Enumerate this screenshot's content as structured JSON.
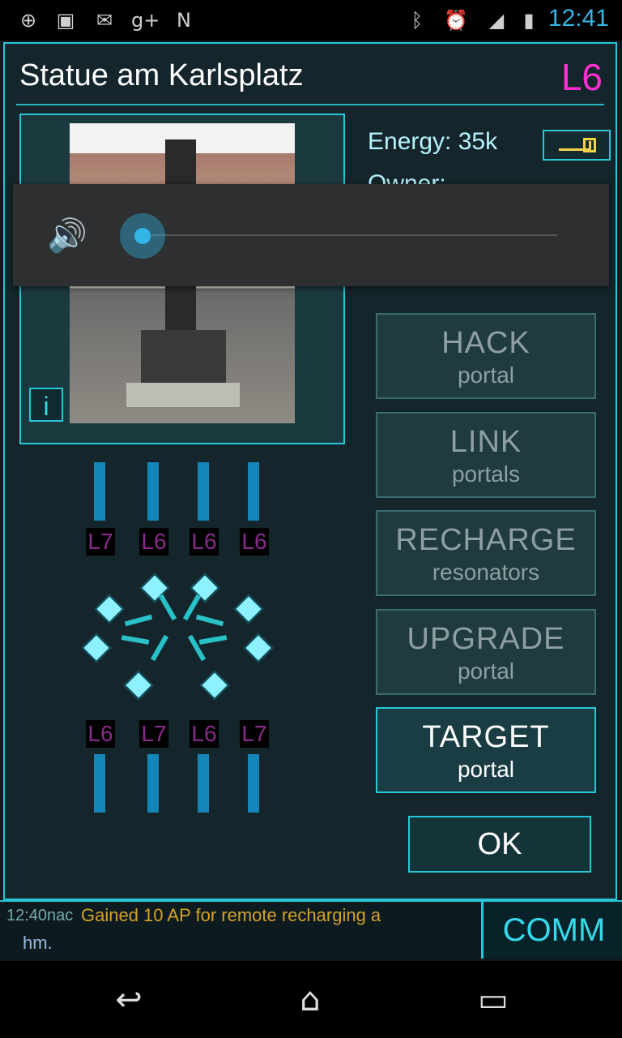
{
  "status_bar": {
    "icons": [
      "location-icon",
      "image-icon",
      "gmail-icon",
      "google-plus-icon",
      "android-icon",
      "bluetooth-icon",
      "alarm-icon",
      "signal-icon",
      "battery-icon"
    ],
    "time": "12:41"
  },
  "portal": {
    "name": "Statue am Karlsplatz",
    "level": "L6",
    "energy_label": "Energy:  35k",
    "owner_label": "Owner:"
  },
  "volume_overlay": {
    "icon": "speaker-icon",
    "level": 0.0
  },
  "actions": [
    {
      "main": "HACK",
      "sub": "portal",
      "active": false
    },
    {
      "main": "LINK",
      "sub": "portals",
      "active": false
    },
    {
      "main": "RECHARGE",
      "sub": "resonators",
      "active": false
    },
    {
      "main": "UPGRADE",
      "sub": "portal",
      "active": false
    },
    {
      "main": "TARGET",
      "sub": "portal",
      "active": true
    }
  ],
  "ok_label": "OK",
  "resonators": {
    "top_levels": [
      "L7",
      "L6",
      "L6",
      "L6"
    ],
    "bottom_levels": [
      "L6",
      "L7",
      "L6",
      "L7"
    ]
  },
  "comm": {
    "time": "12:40nac",
    "message": "Gained 10 AP for remote recharging a",
    "message2": "hm.",
    "button": "COMM"
  },
  "nav": {
    "back": "back-icon",
    "home": "home-icon",
    "recents": "recents-icon"
  }
}
